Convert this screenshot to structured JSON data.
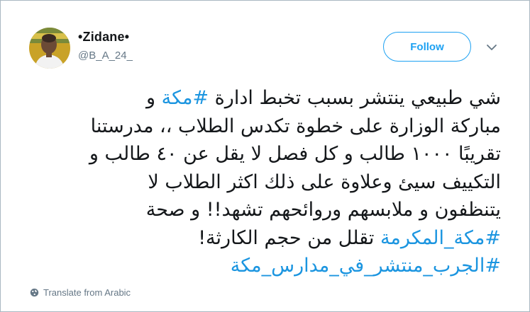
{
  "user": {
    "display_name": "•Zidane•",
    "handle": "@B_A_24_"
  },
  "follow_label": "Follow",
  "tweet": {
    "line1": {
      "before": "شي طبيعي ينتشر بسبب تخبط ادارة ",
      "tag": "#مكة",
      "after": " و"
    },
    "line2": "مباركة الوزارة على خطوة تكدس الطلاب ،، مدرستنا",
    "line3": "تقريبًا ١٠٠٠ طالب و كل فصل لا يقل عن ٤٠ طالب و",
    "line4": "التكييف سيئ وعلاوة على ذلك اكثر الطلاب لا",
    "line5": "يتنظفون و ملابسهم وروائحهم تشهد!! و صحة",
    "line6": {
      "tag": "#مكة_المكرمة",
      "after": " تقلل من حجم الكارثة!"
    },
    "line7": {
      "tag": "#الجرب_منتشر_في_مدارس_مكة"
    }
  },
  "translate_label": "Translate from Arabic",
  "colors": {
    "accent": "#1da1f2",
    "hashtag": "#1b95e0",
    "text": "#14171a",
    "secondary": "#657786"
  },
  "icons": {
    "avatar": "avatar-photo",
    "chevron": "chevron-down-icon",
    "translate": "globe-icon"
  }
}
